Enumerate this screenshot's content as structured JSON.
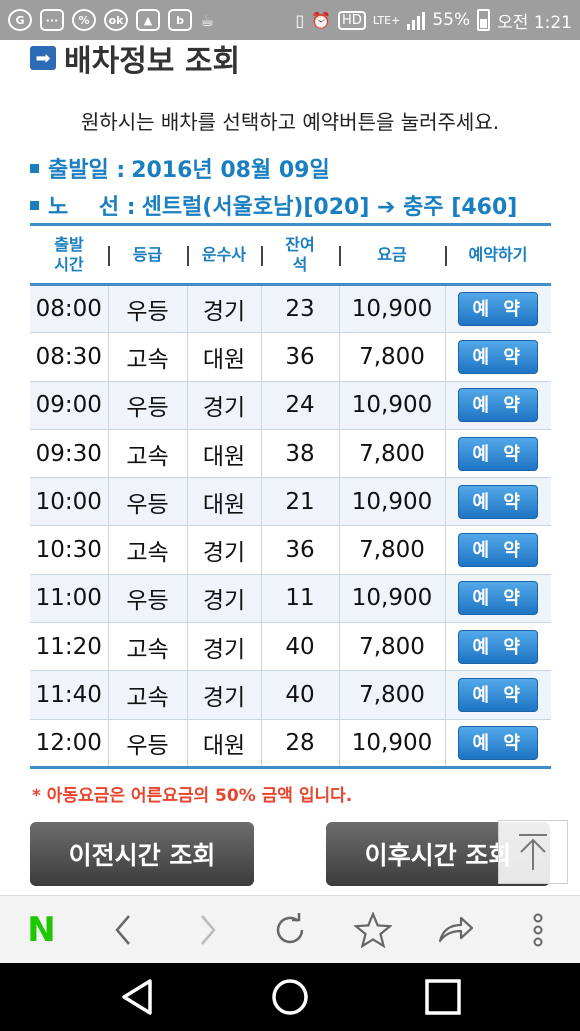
{
  "status_bar": {
    "left_icons": [
      "status-app-icon",
      "message-icon",
      "percent-icon",
      "ok-icon",
      "image-icon",
      "band-icon",
      "cup-icon"
    ],
    "hd_label": "HD",
    "network_label": "LTE+",
    "battery_percent": "55%",
    "time": "오전 1:21"
  },
  "page": {
    "section_title": "배차정보 조회",
    "instruction": "원하시는 배차를 선택하고 예약버튼을 눌러주세요.",
    "departure_label": "출발일 :",
    "departure_value": "2016년 08월 09일",
    "route_label": "노    선 :",
    "route_value": "센트럴(서울호남)[020] ➔ 충주 [460]"
  },
  "table": {
    "headers": [
      "출발\n시간",
      "등급",
      "운수사",
      "잔여\n석",
      "요금",
      "예약하기"
    ],
    "reserve_label": "예 약",
    "rows": [
      {
        "time": "08:00",
        "grade": "우등",
        "company": "경기",
        "seats": "23",
        "fare": "10,900"
      },
      {
        "time": "08:30",
        "grade": "고속",
        "company": "대원",
        "seats": "36",
        "fare": "7,800"
      },
      {
        "time": "09:00",
        "grade": "우등",
        "company": "경기",
        "seats": "24",
        "fare": "10,900"
      },
      {
        "time": "09:30",
        "grade": "고속",
        "company": "대원",
        "seats": "38",
        "fare": "7,800"
      },
      {
        "time": "10:00",
        "grade": "우등",
        "company": "대원",
        "seats": "21",
        "fare": "10,900"
      },
      {
        "time": "10:30",
        "grade": "고속",
        "company": "경기",
        "seats": "36",
        "fare": "7,800"
      },
      {
        "time": "11:00",
        "grade": "우등",
        "company": "경기",
        "seats": "11",
        "fare": "10,900"
      },
      {
        "time": "11:20",
        "grade": "고속",
        "company": "경기",
        "seats": "40",
        "fare": "7,800"
      },
      {
        "time": "11:40",
        "grade": "고속",
        "company": "경기",
        "seats": "40",
        "fare": "7,800"
      },
      {
        "time": "12:00",
        "grade": "우등",
        "company": "대원",
        "seats": "28",
        "fare": "10,900"
      }
    ]
  },
  "note": "* 아동요금은 어른요금의 50% 금액 입니다.",
  "buttons": {
    "prev": "이전시간 조회",
    "next": "이후시간 조회"
  },
  "browser_toolbar": {
    "logo": "N",
    "icons": [
      "naver-logo-icon",
      "back-icon",
      "forward-icon",
      "refresh-icon",
      "bookmark-star-icon",
      "share-icon",
      "more-icon"
    ]
  },
  "system_nav": {
    "icons": [
      "back-triangle-icon",
      "home-circle-icon",
      "recent-apps-square-icon"
    ]
  },
  "colors": {
    "accent": "#1a7fc1",
    "table_rule": "#3d8ec9",
    "note_red": "#e8452c",
    "naver_green": "#1ec800"
  }
}
